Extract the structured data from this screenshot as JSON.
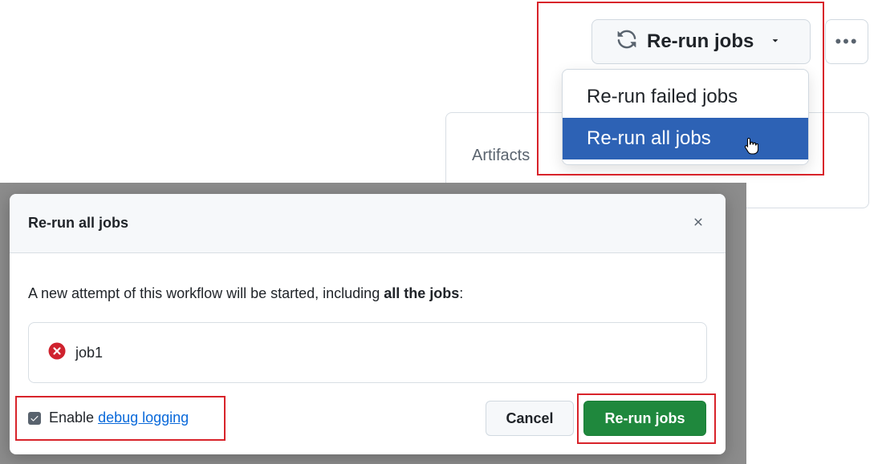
{
  "top": {
    "rerun_button_label": "Re-run jobs",
    "rerun_icon": "sync-icon",
    "caret_icon": "triangle-down-icon",
    "more_icon": "kebab-horizontal-icon",
    "more_label": "•••",
    "artifacts_label": "Artifacts",
    "dropdown": {
      "items": [
        {
          "label": "Re-run failed jobs",
          "active": false
        },
        {
          "label": "Re-run all jobs",
          "active": true
        }
      ]
    },
    "cursor_icon": "hand-pointer-icon"
  },
  "modal": {
    "title": "Re-run all jobs",
    "close_icon": "x-icon",
    "description_prefix": "A new attempt of this workflow will be started, including ",
    "description_bold": "all the jobs",
    "description_suffix": ":",
    "jobs": [
      {
        "name": "job1",
        "status": "failed",
        "status_icon": "x-circle-fill-icon"
      }
    ],
    "debug": {
      "checked": true,
      "label_prefix": "Enable ",
      "link_text": "debug logging"
    },
    "cancel_label": "Cancel",
    "submit_label": "Re-run jobs"
  },
  "colors": {
    "primary_green": "#1f883d",
    "selected_blue": "#2d62b5",
    "annotation_red": "#d8232a",
    "link_blue": "#0969da",
    "error_red": "#cf222e"
  }
}
